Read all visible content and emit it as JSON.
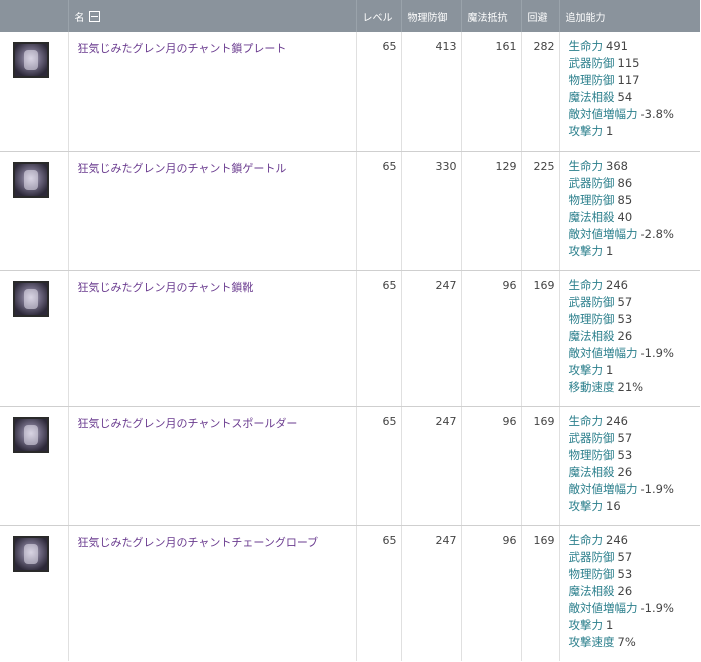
{
  "header": {
    "name": "名",
    "level": "レベル",
    "phys_def": "物理防御",
    "magic_res": "魔法抵抗",
    "evasion": "回避",
    "extra": "追加能力"
  },
  "rows": [
    {
      "icon": "armor-plate-icon",
      "name": "狂気じみたグレン月のチャント鎖プレート",
      "level": "65",
      "phys_def": "413",
      "magic_res": "161",
      "evasion": "282",
      "stats": [
        {
          "label": "生命力",
          "value": "491"
        },
        {
          "label": "武器防御",
          "value": "115"
        },
        {
          "label": "物理防御",
          "value": "117"
        },
        {
          "label": "魔法相殺",
          "value": "54"
        },
        {
          "label": "敵対値増幅力",
          "value": "-3.8%"
        },
        {
          "label": "攻撃力",
          "value": "1"
        }
      ]
    },
    {
      "icon": "leg-armor-icon",
      "name": "狂気じみたグレン月のチャント鎖ゲートル",
      "level": "65",
      "phys_def": "330",
      "magic_res": "129",
      "evasion": "225",
      "stats": [
        {
          "label": "生命力",
          "value": "368"
        },
        {
          "label": "武器防御",
          "value": "86"
        },
        {
          "label": "物理防御",
          "value": "85"
        },
        {
          "label": "魔法相殺",
          "value": "40"
        },
        {
          "label": "敵対値増幅力",
          "value": "-2.8%"
        },
        {
          "label": "攻撃力",
          "value": "1"
        }
      ]
    },
    {
      "icon": "boots-icon",
      "name": "狂気じみたグレン月のチャント鎖靴",
      "level": "65",
      "phys_def": "247",
      "magic_res": "96",
      "evasion": "169",
      "stats": [
        {
          "label": "生命力",
          "value": "246"
        },
        {
          "label": "武器防御",
          "value": "57"
        },
        {
          "label": "物理防御",
          "value": "53"
        },
        {
          "label": "魔法相殺",
          "value": "26"
        },
        {
          "label": "敵対値増幅力",
          "value": "-1.9%"
        },
        {
          "label": "攻撃力",
          "value": "1"
        },
        {
          "label": "移動速度",
          "value": "21%"
        }
      ]
    },
    {
      "icon": "shoulder-armor-icon",
      "name": "狂気じみたグレン月のチャントスポールダー",
      "level": "65",
      "phys_def": "247",
      "magic_res": "96",
      "evasion": "169",
      "stats": [
        {
          "label": "生命力",
          "value": "246"
        },
        {
          "label": "武器防御",
          "value": "57"
        },
        {
          "label": "物理防御",
          "value": "53"
        },
        {
          "label": "魔法相殺",
          "value": "26"
        },
        {
          "label": "敵対値増幅力",
          "value": "-1.9%"
        },
        {
          "label": "攻撃力",
          "value": "16"
        }
      ]
    },
    {
      "icon": "gloves-icon",
      "name": "狂気じみたグレン月のチャントチェーングローブ",
      "level": "65",
      "phys_def": "247",
      "magic_res": "96",
      "evasion": "169",
      "stats": [
        {
          "label": "生命力",
          "value": "246"
        },
        {
          "label": "武器防御",
          "value": "57"
        },
        {
          "label": "物理防御",
          "value": "53"
        },
        {
          "label": "魔法相殺",
          "value": "26"
        },
        {
          "label": "敵対値増幅力",
          "value": "-1.9%"
        },
        {
          "label": "攻撃力",
          "value": "1"
        },
        {
          "label": "攻撃速度",
          "value": "7%"
        }
      ]
    }
  ]
}
